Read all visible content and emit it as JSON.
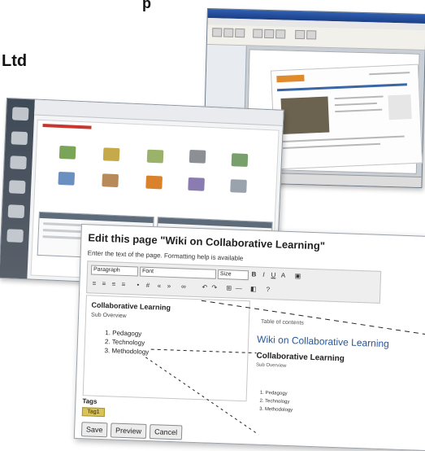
{
  "heading_fragment": "Ltd",
  "heading_top_fragment": "p",
  "editor_window": {
    "side_items": [
      "",
      "",
      ""
    ]
  },
  "dashboard": {
    "section_label": ""
  },
  "wiki_page": {
    "title": "Edit this page \"Wiki on Collaborative Learning\"",
    "help_text": "Enter the text of the page. Formatting help is available",
    "toolbar": {
      "style_select": "Paragraph",
      "font_select": "Font",
      "size_select": "Size"
    },
    "editor": {
      "heading": "Collaborative Learning",
      "subheading": "Sub Overview",
      "list_items": [
        "1. Pedagogy",
        "2. Technology",
        "3. Methodology"
      ]
    },
    "tags_label": "Tags",
    "tag_chip": "Tag1",
    "buttons": {
      "save": "Save",
      "preview": "Preview",
      "cancel": "Cancel"
    },
    "preview": {
      "toc_text": "Table of contents",
      "title": "Wiki on Collaborative Learning",
      "heading": "Collaborative Learning",
      "subheading": "Sub Overview",
      "list_items": [
        "1. Pedagogy",
        "2. Technology",
        "3. Methodology"
      ]
    }
  },
  "colors": {
    "wiki_link_blue": "#2a5a9a",
    "tag_chip": "#d8c35a",
    "titlebar_blue": "#2f5fb2"
  }
}
